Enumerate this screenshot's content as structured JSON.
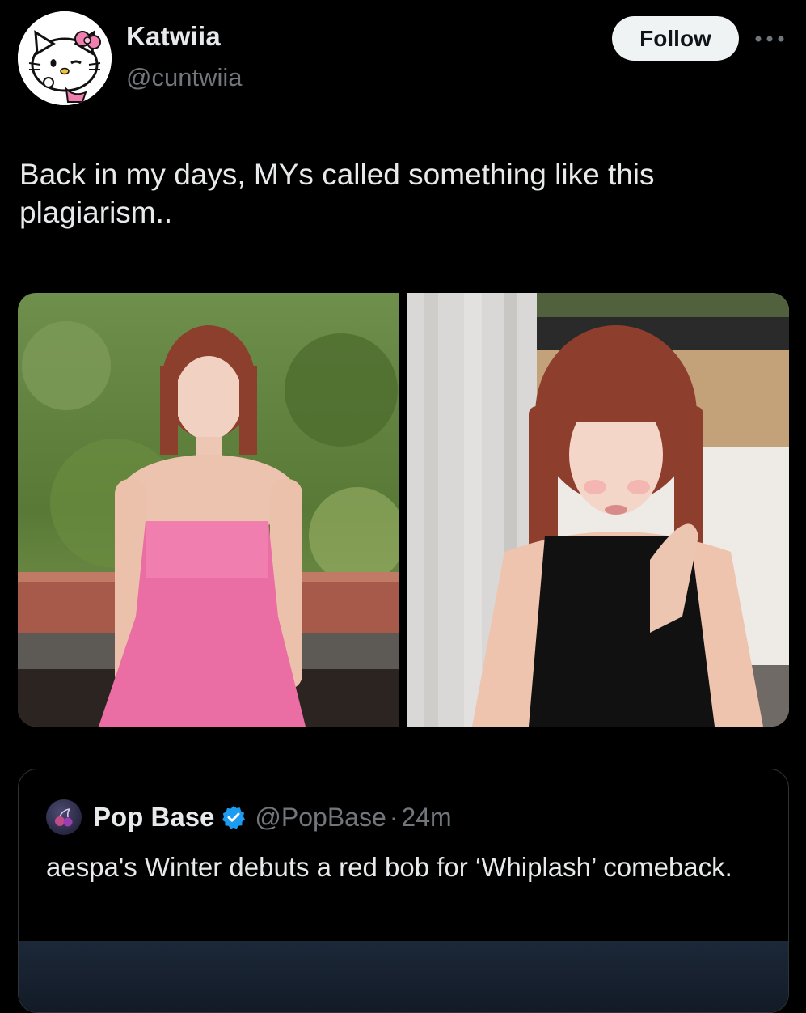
{
  "author": {
    "display_name": "Katwiia",
    "handle": "@cuntwiia",
    "avatar_icon": "hello-kitty-avatar"
  },
  "actions": {
    "follow_label": "Follow",
    "more_icon": "more-dots-icon"
  },
  "tweet": {
    "text": "Back in my days, MYs called something like this plagiarism.."
  },
  "media": {
    "images": [
      {
        "name": "photo-pink-dress",
        "description_icon": "photo"
      },
      {
        "name": "photo-black-top",
        "description_icon": "photo"
      }
    ]
  },
  "quote": {
    "display_name": "Pop Base",
    "handle": "@PopBase",
    "separator": "·",
    "time": "24m",
    "verified_icon": "verified-badge-icon",
    "text": "aespa's Winter debuts a red bob for ‘Whiplash’ comeback."
  },
  "colors": {
    "background": "#000000",
    "text_primary": "#e7e9ea",
    "text_secondary": "#71767b",
    "verified_blue": "#1d9bf0",
    "follow_bg": "#eff3f4",
    "border": "#2f3336"
  }
}
